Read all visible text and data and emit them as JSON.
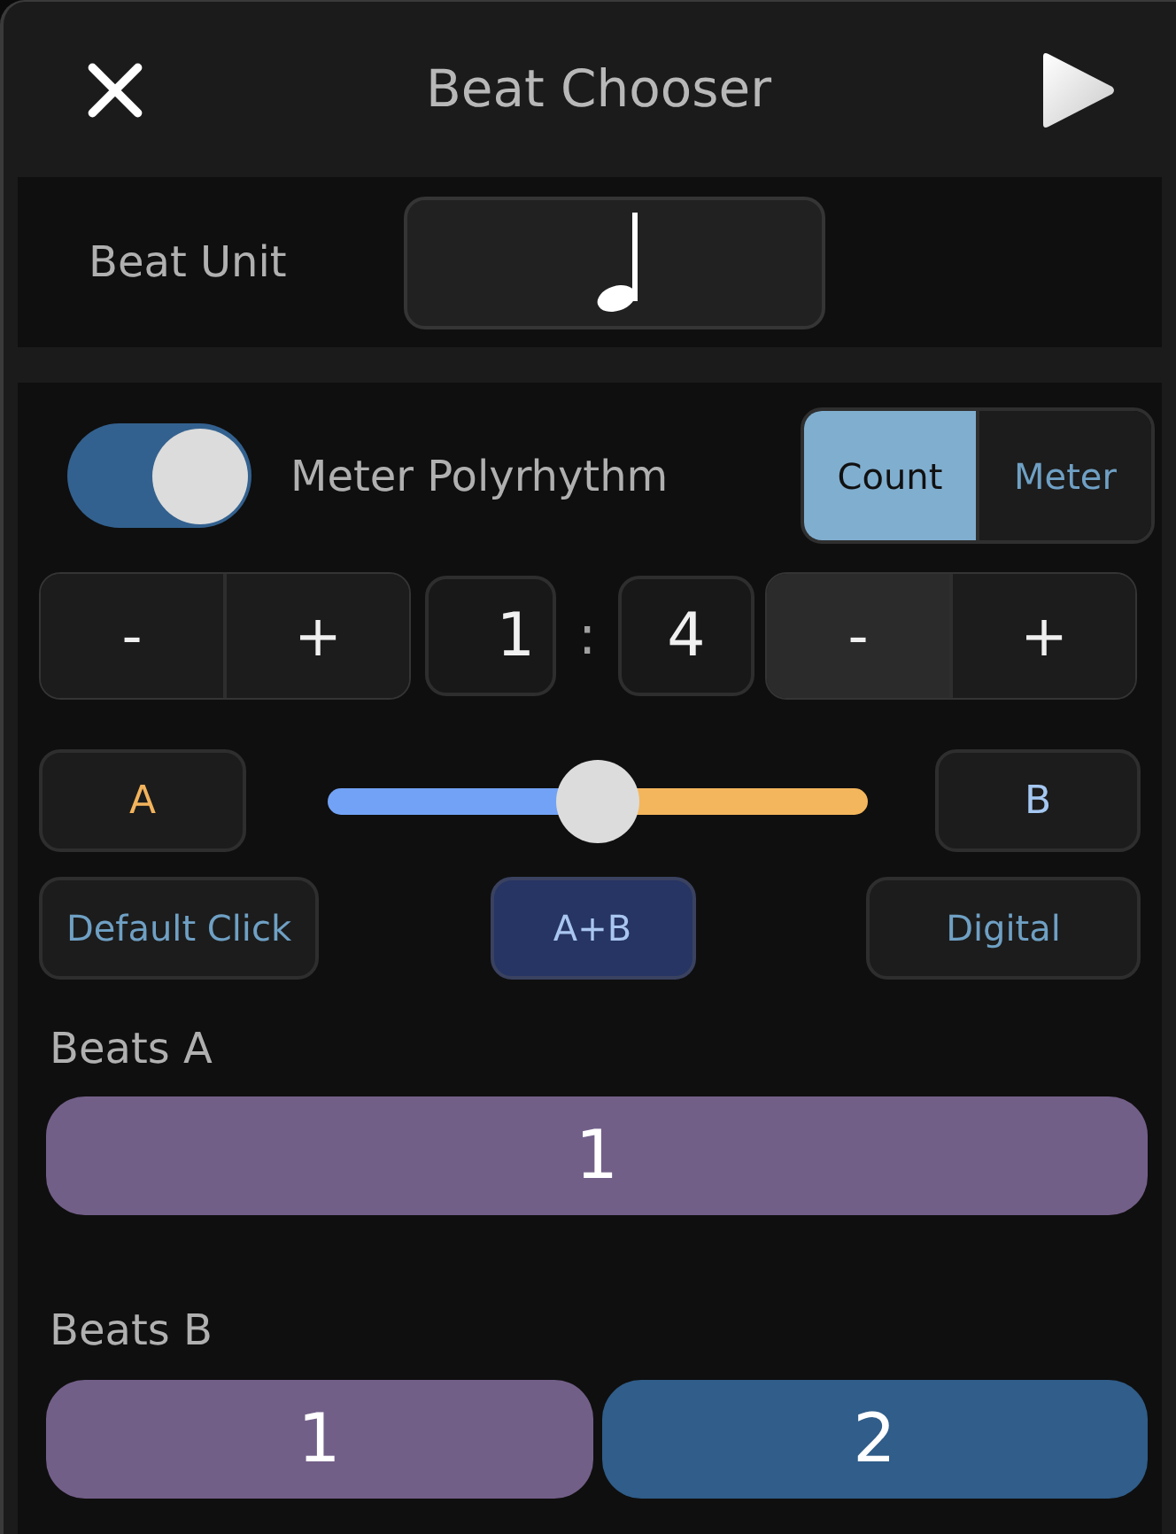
{
  "header": {
    "title": "Beat Chooser"
  },
  "beat_unit": {
    "label": "Beat Unit"
  },
  "polyrhythm": {
    "label": "Meter Polyrhythm",
    "on": true
  },
  "mode_tabs": [
    {
      "label": "Count",
      "selected": true
    },
    {
      "label": "Meter",
      "selected": false
    }
  ],
  "ratio": {
    "left_stepper": [
      {
        "label": "-",
        "pressed": false
      },
      {
        "label": "+",
        "pressed": false
      }
    ],
    "value_a": "1",
    "separator": ":",
    "value_b": "4",
    "right_stepper": [
      {
        "label": "-",
        "pressed": true
      },
      {
        "label": "+",
        "pressed": false
      }
    ]
  },
  "balance": {
    "a_label": "A",
    "b_label": "B",
    "level": 0.5
  },
  "sound_buttons": [
    {
      "label": "Default Click",
      "selected": false
    },
    {
      "label": "A+B",
      "selected": true
    },
    {
      "label": "Digital",
      "selected": false
    }
  ],
  "beats_a": {
    "label": "Beats A",
    "beats": [
      {
        "label": "1",
        "color": "#725f88"
      }
    ]
  },
  "beats_b": {
    "label": "Beats B",
    "beats": [
      {
        "label": "1",
        "color": "#725f88"
      },
      {
        "label": "2",
        "color": "#305d89"
      }
    ]
  }
}
